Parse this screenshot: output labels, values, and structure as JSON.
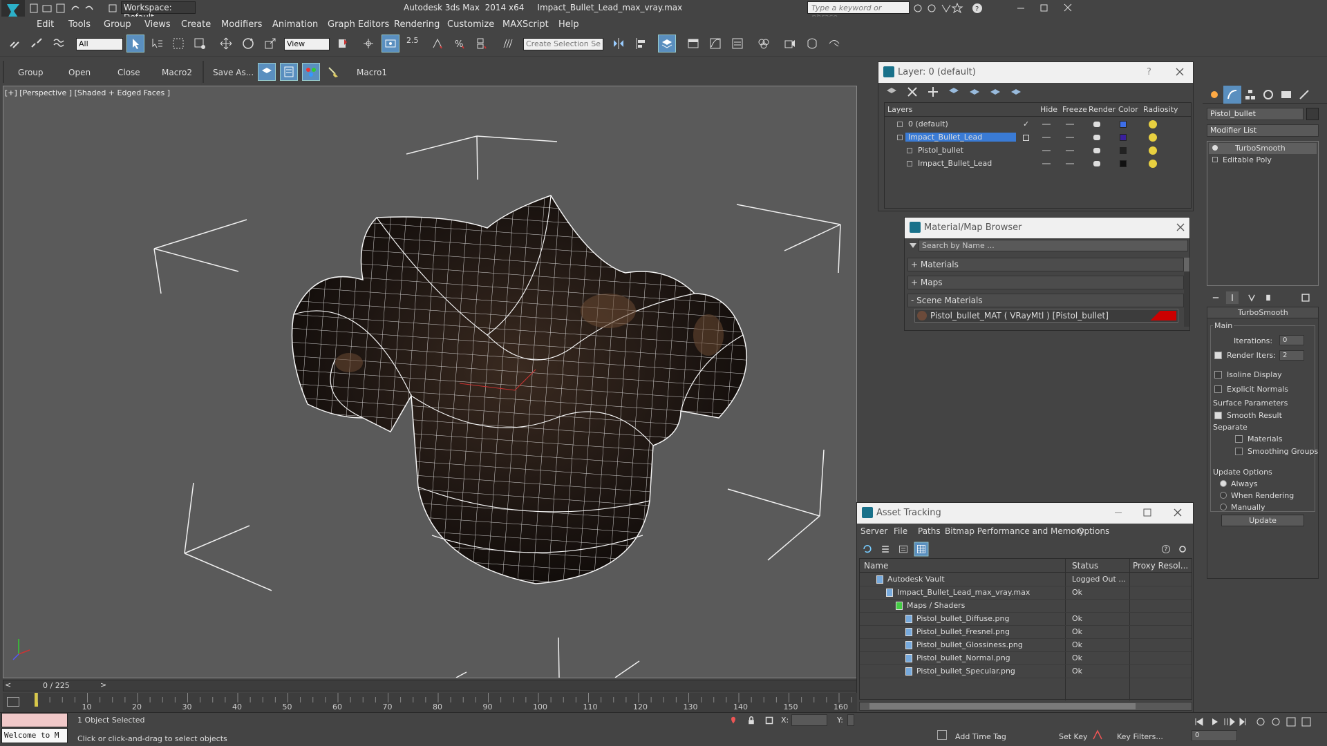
{
  "window": {
    "title": "Autodesk 3ds Max  2014 x64     Impact_Bullet_Lead_max_vray.max",
    "workspace": "Workspace: Default",
    "search_placeholder": "Type a keyword or phrase"
  },
  "menu": [
    "Edit",
    "Tools",
    "Group",
    "Views",
    "Create",
    "Modifiers",
    "Animation",
    "Graph Editors",
    "Rendering",
    "Customize",
    "MAXScript",
    "Help"
  ],
  "toolbar": {
    "selection_filter": "All",
    "ref_coord": "View",
    "named_selection": "Create Selection Se",
    "snap_value": "2.5"
  },
  "toolbar2": [
    "Group",
    "Open",
    "Close",
    "Macro2",
    "Save As...",
    "Macro1"
  ],
  "viewport": {
    "label": "[+] [Perspective ] [Shaded + Edged Faces ]"
  },
  "layer_panel": {
    "title": "Layer: 0 (default)",
    "help": "?",
    "columns": [
      "Layers",
      "Hide",
      "Freeze",
      "Render",
      "Color",
      "Radiosity"
    ],
    "rows": [
      {
        "name": "0 (default)",
        "color": "#3d6ee8",
        "selected": false
      },
      {
        "name": "Impact_Bullet_Lead",
        "color": "#3a1f9e",
        "selected": true
      },
      {
        "name": "Pistol_bullet",
        "color": "#222222",
        "selected": false
      },
      {
        "name": "Impact_Bullet_Lead",
        "color": "#111111",
        "selected": false
      }
    ]
  },
  "material_browser": {
    "title": "Material/Map Browser",
    "search_placeholder": "Search by Name ...",
    "groups": [
      "+ Materials",
      "+ Maps",
      "- Scene Materials"
    ],
    "scene_material": "Pistol_bullet_MAT ( VRayMtl ) [Pistol_bullet]"
  },
  "asset_tracking": {
    "title": "Asset Tracking",
    "menu": [
      "Server",
      "File",
      "Paths",
      "Bitmap Performance and Memory",
      "Options"
    ],
    "columns": [
      "Name",
      "Status",
      "Proxy Resol..."
    ],
    "rows": [
      {
        "name": "Autodesk Vault",
        "status": "Logged Out ...",
        "indent": 1
      },
      {
        "name": "Impact_Bullet_Lead_max_vray.max",
        "status": "Ok",
        "indent": 2
      },
      {
        "name": "Maps / Shaders",
        "status": "",
        "indent": 3
      },
      {
        "name": "Pistol_bullet_Diffuse.png",
        "status": "Ok",
        "indent": 4
      },
      {
        "name": "Pistol_bullet_Fresnel.png",
        "status": "Ok",
        "indent": 4
      },
      {
        "name": "Pistol_bullet_Glossiness.png",
        "status": "Ok",
        "indent": 4
      },
      {
        "name": "Pistol_bullet_Normal.png",
        "status": "Ok",
        "indent": 4
      },
      {
        "name": "Pistol_bullet_Specular.png",
        "status": "Ok",
        "indent": 4
      }
    ]
  },
  "command_panel": {
    "object_name": "Pistol_bullet",
    "modifier_list": "Modifier List",
    "stack": [
      "TurboSmooth",
      "Editable Poly"
    ],
    "rollout_title": "TurboSmooth",
    "main_label": "Main",
    "iterations_label": "Iterations:",
    "iterations_value": "0",
    "render_iters_label": "Render Iters:",
    "render_iters_value": "2",
    "isoline": "Isoline Display",
    "explicit_normals": "Explicit Normals",
    "surface_params": "Surface Parameters",
    "smooth_result": "Smooth Result",
    "separate": "Separate",
    "materials": "Materials",
    "smoothing_groups": "Smoothing Groups",
    "update_options": "Update Options",
    "always": "Always",
    "when_rendering": "When Rendering",
    "manually": "Manually",
    "update_button": "Update"
  },
  "timeline": {
    "frame": "0 / 225",
    "ticks": [
      "10",
      "20",
      "30",
      "40",
      "50",
      "60",
      "70",
      "80",
      "90",
      "100",
      "110",
      "120",
      "130",
      "140",
      "150",
      "160"
    ]
  },
  "status": {
    "maxscript": "Welcome to M",
    "selected": "1 Object Selected",
    "prompt": "Click or click-and-drag to select objects",
    "x_label": "X:",
    "y_label": "Y:",
    "add_time_tag": "Add Time Tag",
    "set_key": "Set Key",
    "key_filters": "Key Filters...",
    "frame_field": "0"
  }
}
